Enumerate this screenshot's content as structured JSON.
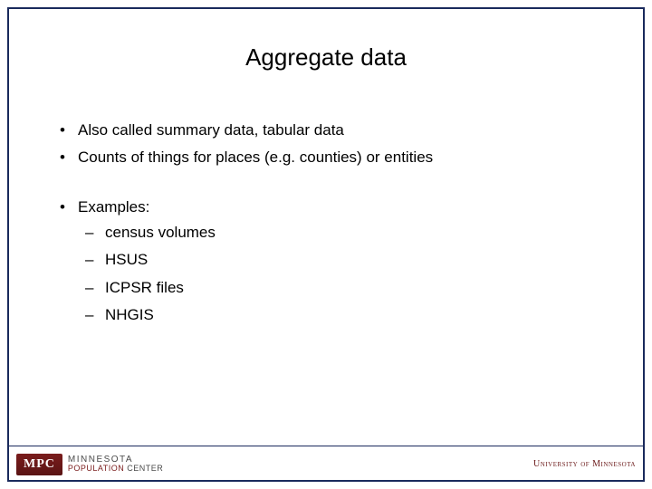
{
  "title": "Aggregate data",
  "bullets": [
    "Also called summary data, tabular data",
    "Counts of things for places (e.g. counties) or entities"
  ],
  "examples_label": "Examples:",
  "examples": [
    "census volumes",
    "HSUS",
    "ICPSR files",
    "NHGIS"
  ],
  "footer": {
    "left_acronym": "MPC",
    "left_line1": "MINNESOTA",
    "left_line2a": "POPULATION",
    "left_line2b": "CENTER",
    "right": "University of Minnesota"
  }
}
